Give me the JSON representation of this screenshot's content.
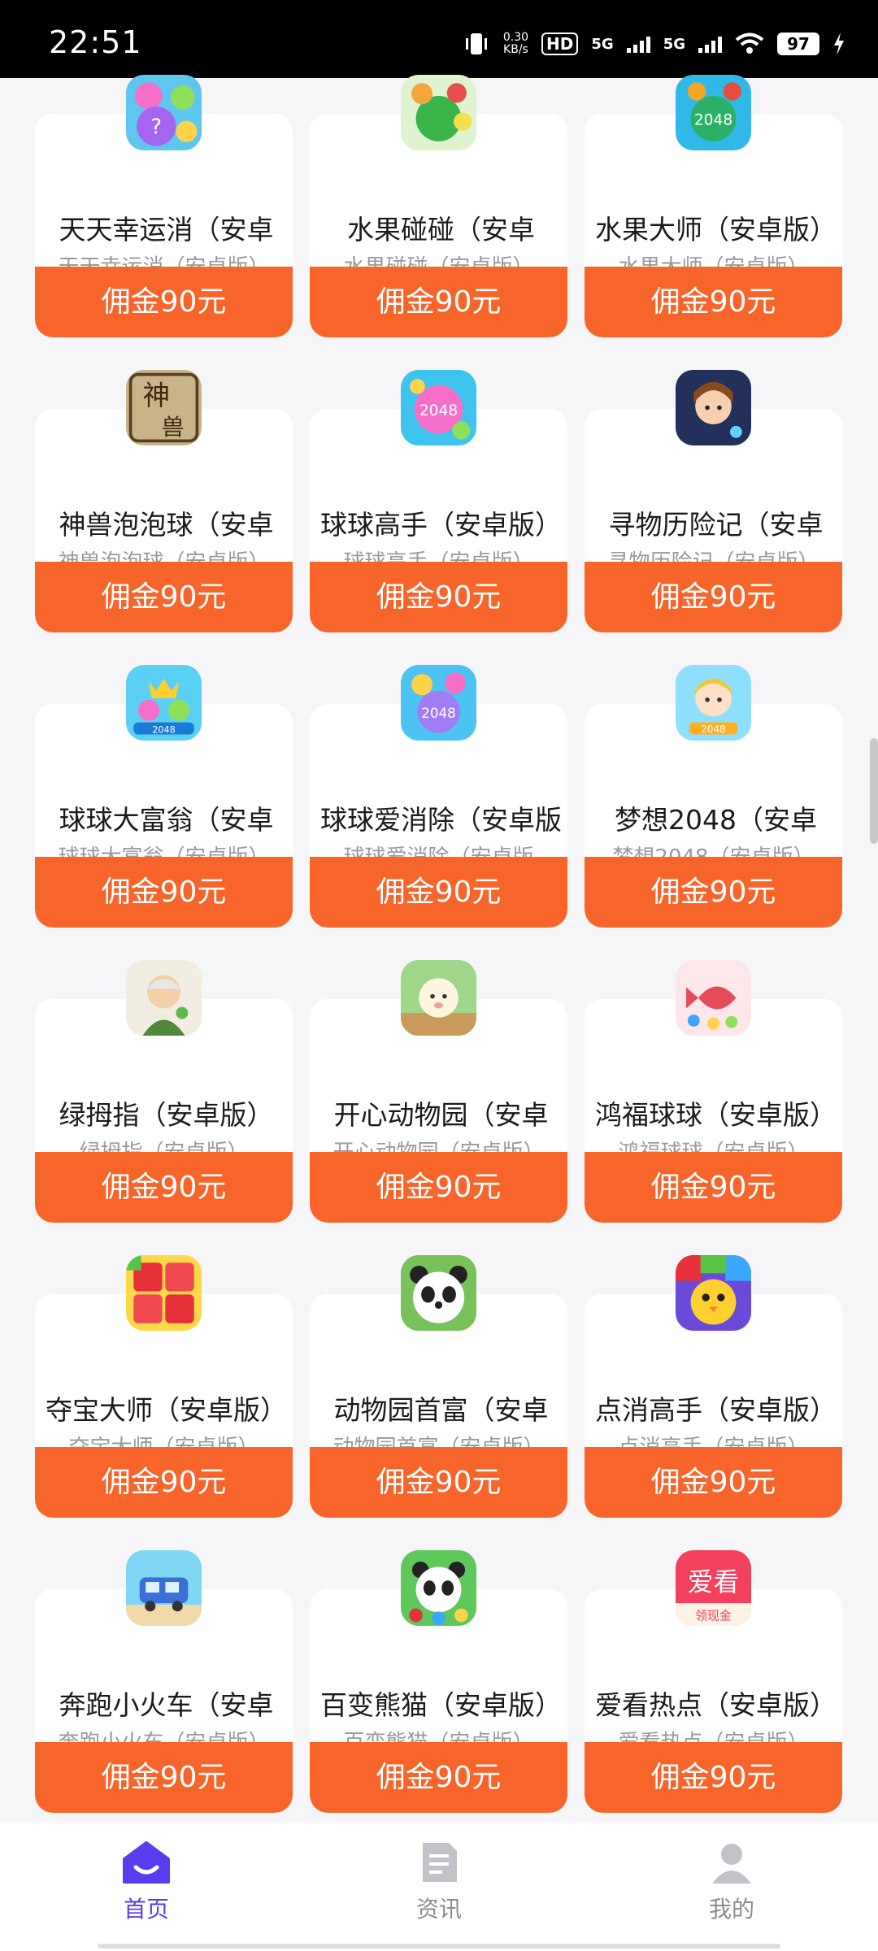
{
  "status_bar": {
    "time": "22:51",
    "net_speed": "0.30",
    "net_unit": "KB/s",
    "hd": "HD",
    "sig1": "5G",
    "sig2": "5G",
    "battery": "97"
  },
  "apps": [
    {
      "name": "天天幸运消（安卓",
      "sub": "天天幸运消（安卓版）",
      "button": "佣金90元",
      "icon": "lucky-bubble-icon"
    },
    {
      "name": "水果碰碰（安卓",
      "sub": "水果碰碰（安卓版）",
      "button": "佣金90元",
      "icon": "fruit-bubble-icon"
    },
    {
      "name": "水果大师（安卓版）",
      "sub": "水果大师（安卓版）",
      "button": "佣金90元",
      "icon": "fruit-2048-icon"
    },
    {
      "name": "神兽泡泡球（安卓",
      "sub": "神兽泡泡球（安卓版）",
      "button": "佣金90元",
      "icon": "beast-icon"
    },
    {
      "name": "球球高手（安卓版）",
      "sub": "球球高手（安卓版）",
      "button": "佣金90元",
      "icon": "ball-2048-icon"
    },
    {
      "name": "寻物历险记（安卓",
      "sub": "寻物历险记（安卓版）",
      "button": "佣金90元",
      "icon": "girl-adventure-icon"
    },
    {
      "name": "球球大富翁（安卓",
      "sub": "球球大富翁（安卓版）",
      "button": "佣金90元",
      "icon": "ball-tycoon-icon"
    },
    {
      "name": "球球爱消除（安卓版",
      "sub": "球球爱消除（安卓版",
      "button": "佣金90元",
      "icon": "ball-eliminate-icon"
    },
    {
      "name": "梦想2048（安卓",
      "sub": "梦想2048（安卓版）",
      "button": "佣金90元",
      "icon": "dream-2048-icon"
    },
    {
      "name": "绿拇指（安卓版）",
      "sub": "绿拇指（安卓版）",
      "button": "佣金90元",
      "icon": "grandpa-icon"
    },
    {
      "name": "开心动物园（安卓",
      "sub": "开心动物园（安卓版）",
      "button": "佣金90元",
      "icon": "zoo-sheep-icon"
    },
    {
      "name": "鸿福球球（安卓版）",
      "sub": "鸿福球球（安卓版）",
      "button": "佣金90元",
      "icon": "lucky-fish-icon"
    },
    {
      "name": "夺宝大师（安卓版）",
      "sub": "夺宝大师（安卓版）",
      "button": "佣金90元",
      "icon": "red-blocks-icon"
    },
    {
      "name": "动物园首富（安卓",
      "sub": "动物园首富（安卓版）",
      "button": "佣金90元",
      "icon": "panda-icon"
    },
    {
      "name": "点消高手（安卓版）",
      "sub": "点消高手（安卓版）",
      "button": "佣金90元",
      "icon": "chick-blocks-icon"
    },
    {
      "name": "奔跑小火车（安卓",
      "sub": "奔跑小火车（安卓版）",
      "button": "佣金90元",
      "icon": "train-icon"
    },
    {
      "name": "百变熊猫（安卓版）",
      "sub": "百变熊猫（安卓版）",
      "button": "佣金90元",
      "icon": "panda-bubble-icon"
    },
    {
      "name": "爱看热点（安卓版）",
      "sub": "爱看热点（安卓版）",
      "button": "佣金90元",
      "icon": "aikan-icon"
    }
  ],
  "aikan_icon_text": {
    "big": "爱看",
    "small": "领现金"
  },
  "nav": {
    "home": "首页",
    "news": "资讯",
    "mine": "我的"
  },
  "colors": {
    "accent": "#f7652b",
    "nav_active": "#5a3cf0",
    "background": "#f6f6f8"
  }
}
